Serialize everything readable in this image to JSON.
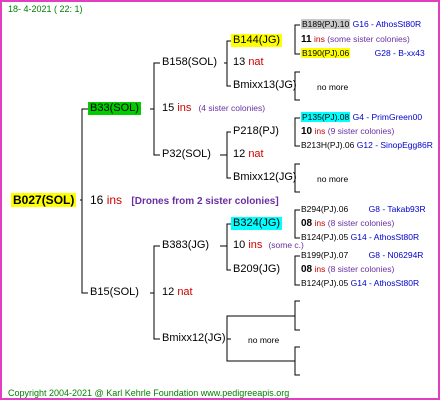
{
  "header": "18-  4-2021  ( 22:  1)",
  "footer": "Copyright 2004-2021 @ Karl Kehrle Foundation    www.pedigreeapis.org",
  "colors": {
    "frame": "#e040c0",
    "yellow": "#ffff00",
    "green": "#00cc00",
    "cyan": "#00ffff",
    "gray": "#c8c8c8",
    "red": "#cc0000",
    "purple": "#6a2fa0",
    "blue": "#0000cc",
    "footer": "#008000"
  },
  "root": {
    "name": "B027(SOL)",
    "count": "16",
    "unit": "ins",
    "note": "[Drones from 2 sister colonies]"
  },
  "mother": {
    "name": "B33(SOL)",
    "count": "15",
    "unit": "ins",
    "note": "(4 sister colonies)"
  },
  "father": {
    "name": "B15(SOL)",
    "count": "12",
    "unit": "nat"
  },
  "mm": {
    "name": "B158(SOL)",
    "count": "13",
    "unit": "nat"
  },
  "mf": {
    "name": "P32(SOL)",
    "count": "12",
    "unit": "nat"
  },
  "fm": {
    "name": "B383(JG)",
    "count": "10",
    "unit": "ins",
    "note": "(some c.)"
  },
  "ff": {
    "name": "Bmixx12(JG)",
    "note": "no more"
  },
  "mmm": {
    "name": "B144(JG)"
  },
  "mmf": {
    "name": "Bmixx13(JG)",
    "note": "no more"
  },
  "mfm": {
    "name": "P218(PJ)"
  },
  "mff": {
    "name": "Bmixx12(JG)",
    "note": "no more"
  },
  "fmm": {
    "name": "B324(JG)"
  },
  "fmf": {
    "name": "B209(JG)"
  },
  "g4": [
    {
      "a": "B189(PJ).10",
      "b": "G16 - AthosSt80R"
    },
    {
      "count": "11",
      "unit": "ins",
      "note": "(some sister colonies)"
    },
    {
      "a": "B190(PJ).06",
      "b": "G28 - B-xx43"
    },
    {
      "a": "P135(PJ).08",
      "b": "G4 - PrimGreen00"
    },
    {
      "count": "10",
      "unit": "ins",
      "note": "(9 sister colonies)"
    },
    {
      "a": "B213H(PJ).06",
      "b": "G12 - SinopEgg86R"
    },
    {
      "a": "B294(PJ).06",
      "b": "G8 - Takab93R"
    },
    {
      "count": "08",
      "unit": "ins",
      "note": "(8 sister colonies)"
    },
    {
      "a": "B124(PJ).05",
      "b": "G14 - AthosSt80R"
    },
    {
      "a": "B199(PJ).07",
      "b": "G8 - N06294R"
    },
    {
      "count": "08",
      "unit": "ins",
      "note": "(8 sister colonies)"
    },
    {
      "a": "B124(PJ).05",
      "b": "G14 - AthosSt80R"
    }
  ]
}
